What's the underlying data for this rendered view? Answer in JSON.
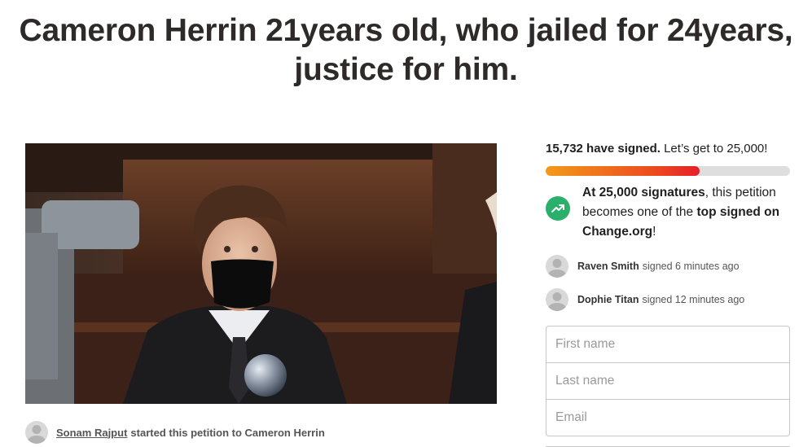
{
  "petition": {
    "title": "Cameron Herrin 21years old, who jailed for 24years, justice for him."
  },
  "starter": {
    "name": "Sonam Rajput",
    "text": "started this petition to Cameron Herrin"
  },
  "signatures": {
    "count_text": "15,732 have signed.",
    "goal_text": "Let’s get to 25,000!",
    "progress_fraction": 0.6293,
    "colors": {
      "progress_start": "#f39a1a",
      "progress_end": "#e5202a",
      "track": "#dedede"
    }
  },
  "milestone": {
    "icon": "trending-up-icon",
    "icon_color": "#2bb06b",
    "part1": "At 25,000 signatures",
    "part2": ", this petition becomes one of the ",
    "part3": "top signed on Change.org",
    "part4": "!"
  },
  "recent_signers": [
    {
      "name": "Raven Smith",
      "action": "signed 6 minutes ago"
    },
    {
      "name": "Dophie Titan",
      "action": "signed 12 minutes ago"
    }
  ],
  "form": {
    "first_name_placeholder": "First name",
    "last_name_placeholder": "Last name",
    "email_placeholder": "Email"
  }
}
